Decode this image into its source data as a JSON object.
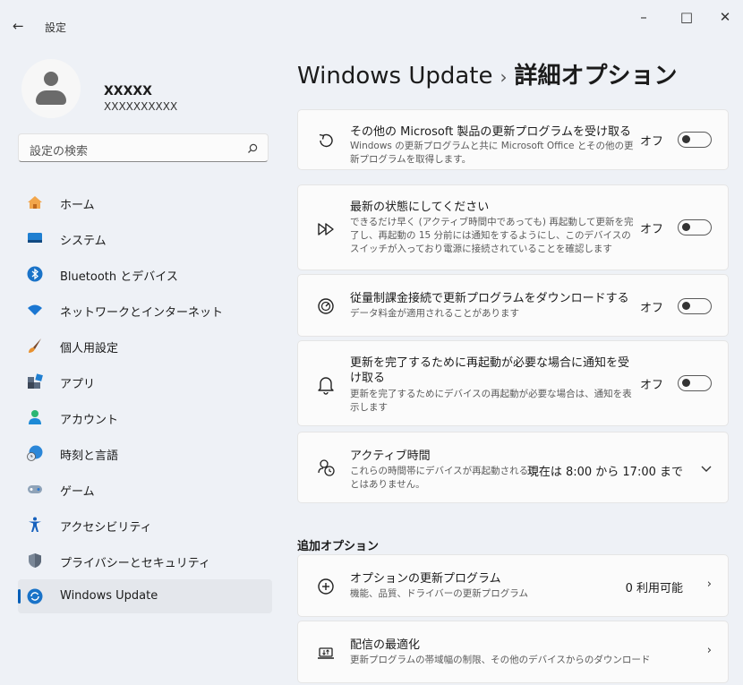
{
  "window": {
    "back_icon": "arrow-left-icon",
    "title": "設定",
    "minimize": "–",
    "maximize": "□",
    "close": "✕"
  },
  "user": {
    "name": "XXXXX",
    "email": "XXXXXXXXXX"
  },
  "search": {
    "placeholder": "設定の検索",
    "icon": "search-icon"
  },
  "nav": {
    "items": [
      {
        "label": "ホーム",
        "icon": "home-icon"
      },
      {
        "label": "システム",
        "icon": "system-icon"
      },
      {
        "label": "Bluetooth とデバイス",
        "icon": "bluetooth-icon"
      },
      {
        "label": "ネットワークとインターネット",
        "icon": "network-icon"
      },
      {
        "label": "個人用設定",
        "icon": "personalization-icon"
      },
      {
        "label": "アプリ",
        "icon": "apps-icon"
      },
      {
        "label": "アカウント",
        "icon": "account-icon"
      },
      {
        "label": "時刻と言語",
        "icon": "time-language-icon"
      },
      {
        "label": "ゲーム",
        "icon": "gaming-icon"
      },
      {
        "label": "アクセシビリティ",
        "icon": "accessibility-icon"
      },
      {
        "label": "プライバシーとセキュリティ",
        "icon": "privacy-icon"
      },
      {
        "label": "Windows Update",
        "icon": "windows-update-icon",
        "active": true
      }
    ]
  },
  "header": {
    "section": "Windows Update",
    "separator": "›",
    "page": "詳細オプション"
  },
  "settings": {
    "other_products": {
      "title": "その他の Microsoft 製品の更新プログラムを受け取る",
      "desc": "Windows の更新プログラムと共に Microsoft Office とその他の更新プログラムを取得します。",
      "state": "オフ",
      "on": false
    },
    "up_to_date": {
      "title": "最新の状態にしてください",
      "desc": "できるだけ早く (アクティブ時間中であっても) 再起動して更新を完了し、再起動の 15 分前には通知をするようにし、このデバイスのスイッチが入っており電源に接続されていることを確認します",
      "state": "オフ",
      "on": false
    },
    "metered": {
      "title": "従量制課金接続で更新プログラムをダウンロードする",
      "desc": "データ料金が適用されることがあります",
      "state": "オフ",
      "on": false
    },
    "restart_notify": {
      "title": "更新を完了するために再起動が必要な場合に通知を受け取る",
      "desc": "更新を完了するためにデバイスの再起動が必要な場合は、通知を表示します",
      "state": "オフ",
      "on": false
    },
    "active_hours": {
      "title": "アクティブ時間",
      "desc": "これらの時間帯にデバイスが再起動されることはありません。",
      "value": "現在は 8:00 から 17:00 まで"
    }
  },
  "additional": {
    "heading": "追加オプション",
    "optional_updates": {
      "title": "オプションの更新プログラム",
      "desc": "機能、品質、ドライバーの更新プログラム",
      "value": "0 利用可能"
    },
    "delivery_optimization": {
      "title": "配信の最適化",
      "desc": "更新プログラムの帯域幅の制限、その他のデバイスからのダウンロード"
    }
  },
  "colors": {
    "accent": "#005fb8",
    "background": "#eef1f6",
    "card": "#fbfbfb"
  }
}
